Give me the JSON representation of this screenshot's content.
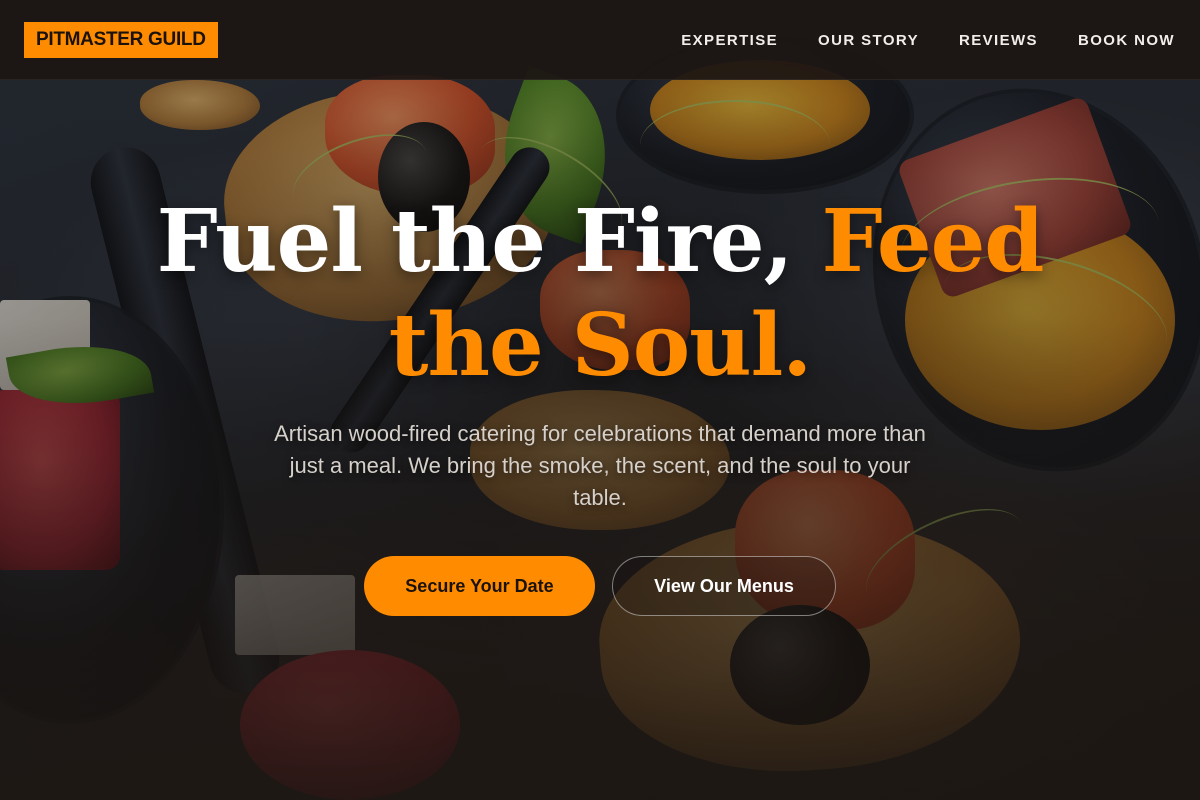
{
  "brand": {
    "logo_text": "PITMASTER GUILD"
  },
  "nav": {
    "items": [
      {
        "label": "EXPERTISE"
      },
      {
        "label": "OUR STORY"
      },
      {
        "label": "REVIEWS"
      },
      {
        "label": "BOOK NOW"
      }
    ]
  },
  "hero": {
    "headline_main": "Fuel the Fire, ",
    "headline_accent": "Feed the Soul.",
    "subtitle": "Artisan wood-fired catering for celebrations that demand more than just a meal. We bring the smoke, the scent, and the soul to your table.",
    "primary_cta": "Secure Your Date",
    "secondary_cta": "View Our Menus",
    "background_image": "plated appetizers on black spoons and toasted bread"
  },
  "colors": {
    "accent": "#ff8c00",
    "nav_background": "#1c1613",
    "text_light": "#ffffff",
    "text_muted": "#d6d0ca"
  }
}
